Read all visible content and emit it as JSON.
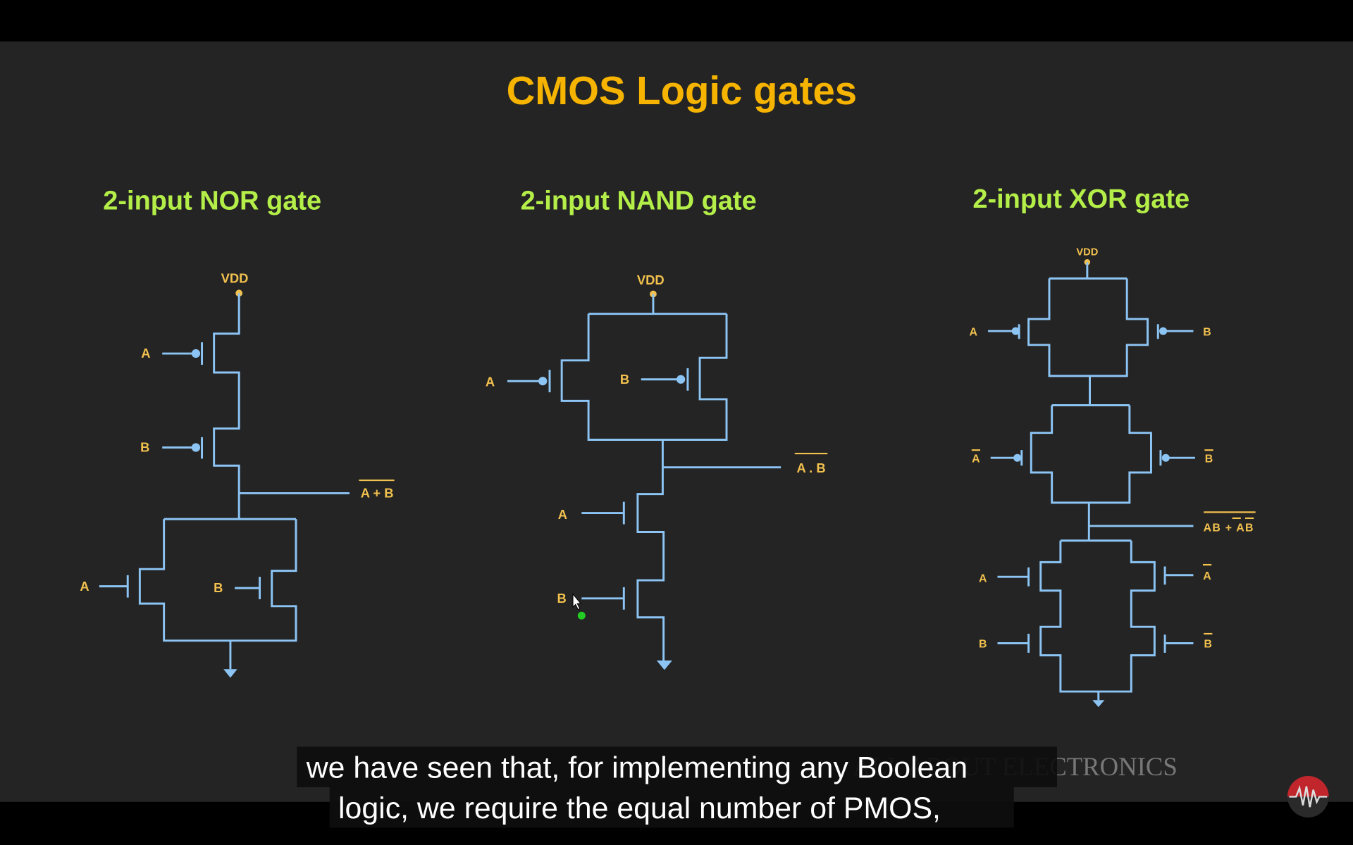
{
  "title": "CMOS Logic gates",
  "nor": {
    "heading": "2-input NOR gate",
    "vdd": "VDD",
    "pmos_inputs": [
      "A",
      "B"
    ],
    "nmos_inputs": [
      "A",
      "B"
    ],
    "output": "A + B"
  },
  "nand": {
    "heading": "2-input NAND gate",
    "vdd": "VDD",
    "pmos_inputs": [
      "A",
      "B"
    ],
    "nmos_inputs": [
      "A",
      "B"
    ],
    "output": "A . B"
  },
  "xor": {
    "heading": "2-input XOR gate",
    "vdd": "VDD",
    "pmos_row1": [
      "A",
      "B"
    ],
    "pmos_row2": [
      "A",
      "B"
    ],
    "nmos_left": [
      "A",
      "B"
    ],
    "nmos_right": [
      "A",
      "B"
    ],
    "output": "AB + AB"
  },
  "watermark": "ALL ABOUT ELECTRONICS",
  "captions": [
    "we have seen that, for implementing any Boolean",
    "logic, we require the equal number of PMOS,"
  ],
  "colors": {
    "title": "#f6b400",
    "heading": "#b4ee48",
    "wire": "#8cc4f4",
    "label": "#f2c14e",
    "logo": "#c0262b"
  }
}
